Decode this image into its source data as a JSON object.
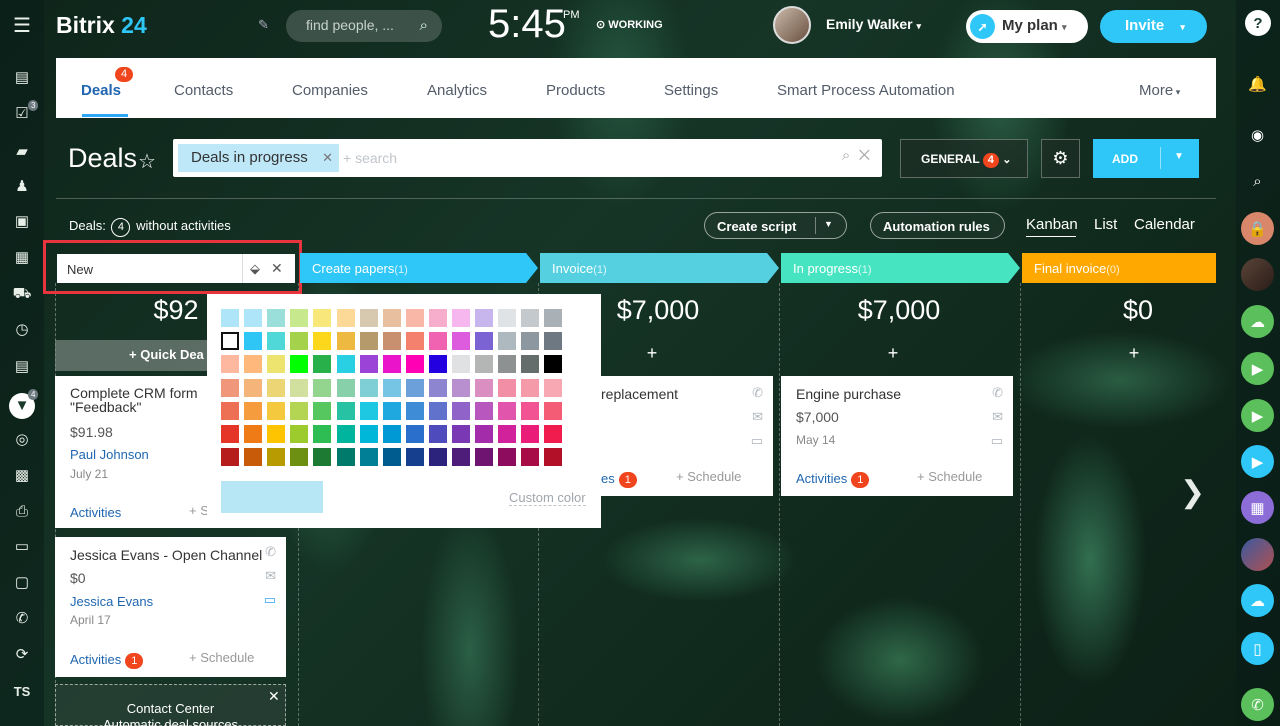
{
  "app": {
    "logo_a": "Bitrix",
    "logo_b": " 24",
    "search_placeholder": "find people, ...",
    "time": "5:45",
    "ampm": "PM",
    "status": "WORKING",
    "user": "Emily Walker",
    "myplan": "My plan",
    "invite": "Invite"
  },
  "left_badges": {
    "tasks": "3",
    "crm": "4"
  },
  "left_bottom": "TS",
  "tabs": [
    {
      "label": "Deals",
      "badge": "4"
    },
    {
      "label": "Contacts"
    },
    {
      "label": "Companies"
    },
    {
      "label": "Analytics"
    },
    {
      "label": "Products"
    },
    {
      "label": "Settings"
    },
    {
      "label": "Smart Process Automation"
    },
    {
      "label": "More"
    }
  ],
  "page": {
    "title": "Deals",
    "filter_chip": "Deals in progress",
    "filter_placeholder": "+ search",
    "general": "GENERAL",
    "general_badge": "4",
    "add": "ADD"
  },
  "subbar": {
    "deals_label": "Deals:",
    "deals_count": "4",
    "deals_suffix": "without activities",
    "create_script": "Create script",
    "automation_rules": "Automation rules",
    "views": [
      "Kanban",
      "List",
      "Calendar"
    ]
  },
  "columns": [
    {
      "name": "New",
      "count": "",
      "sum": "$92",
      "color": "#ffffff"
    },
    {
      "name": "Create papers",
      "count": "(1)",
      "sum": "",
      "color": "#2fc7f7"
    },
    {
      "name": "Invoice",
      "count": "(1)",
      "sum": "$7,000",
      "color": "#55d0e0"
    },
    {
      "name": "In progress",
      "count": "(1)",
      "sum": "$7,000",
      "color": "#47e4c2"
    },
    {
      "name": "Final invoice",
      "count": "(0)",
      "sum": "$0",
      "color": "#ffa900"
    }
  ],
  "quick_deal": "+ Quick Dea",
  "cards": {
    "c1": {
      "title": "Complete CRM form \"Feedback\"",
      "amount": "$91.98",
      "contact": "Paul Johnson",
      "date": "July 21",
      "activities": "Activities",
      "schedule": "+ S"
    },
    "c2": {
      "title": "Jessica Evans - Open Channel",
      "amount": "$0",
      "contact": "Jessica Evans",
      "date": "April 17",
      "activities": "Activities",
      "badge": "1",
      "schedule": "+ Schedule"
    },
    "c3": {
      "title": "replacement",
      "activities": "es",
      "badge": "1",
      "schedule": "+ Schedule"
    },
    "c4": {
      "title": "Engine purchase",
      "amount": "$7,000",
      "date": "May 14",
      "activities": "Activities",
      "badge": "1",
      "schedule": "+ Schedule"
    }
  },
  "contact_center": {
    "title": "Contact Center",
    "subtitle": "Automatic deal sources"
  },
  "palette": {
    "custom_label": "Custom color",
    "rows": [
      [
        "#aee5f8",
        "#aee5f8",
        "#9adfd9",
        "#c8e88d",
        "#f8e87c",
        "#fcd996",
        "#d6c9b0",
        "#e8c0a0",
        "#f8b7a7",
        "#f7aecd",
        "#f6b6ee",
        "#c7b6ee",
        "#dfe3e6",
        "#c3c9cd",
        "#a9b1b7"
      ],
      [
        "#ffffff",
        "#2fc6f6",
        "#50d7d7",
        "#a4d34b",
        "#fcd71c",
        "#eeb941",
        "#b59b6c",
        "#c99070",
        "#f4816d",
        "#f063b1",
        "#dc5cdd",
        "#7b63d4",
        "#adb8bf",
        "#8c97a0",
        "#6d7882"
      ],
      [
        "#ffb8a0",
        "#ffb87c",
        "#ede36f",
        "#00ff00",
        "#28b04a",
        "#29cfe2",
        "#9b43d6",
        "#ea14cb",
        "#ff00b4",
        "#2200e0",
        "#dfe1e2",
        "#b4b5b5",
        "#8d9192",
        "#656c6c",
        "#000000"
      ],
      [
        "#f0967a",
        "#f5b57a",
        "#ecd574",
        "#d1e09f",
        "#93d48e",
        "#87d0a9",
        "#7ed0d6",
        "#77c5e4",
        "#6ca0db",
        "#8d85cf",
        "#b990cf",
        "#db8ec2",
        "#f28ea6",
        "#f59aa9",
        "#f7a8b3"
      ],
      [
        "#ed7054",
        "#f59d3e",
        "#f4c93d",
        "#b4d453",
        "#56c75f",
        "#27c2a4",
        "#1ec8e3",
        "#1fa8e0",
        "#3e8cd6",
        "#6172cc",
        "#8f63c8",
        "#b858be",
        "#e255ad",
        "#f25493",
        "#f45b75"
      ],
      [
        "#e53428",
        "#ef7b16",
        "#ffc400",
        "#9dcb2e",
        "#2dbd52",
        "#00b59e",
        "#00b6d9",
        "#0099d6",
        "#2a6fcb",
        "#4e4cbd",
        "#7b38b5",
        "#a32caa",
        "#d1219b",
        "#ea1e78",
        "#f01c4d"
      ],
      [
        "#b71c1c",
        "#c75b0a",
        "#b79b00",
        "#6d8f12",
        "#1d7a32",
        "#007a6a",
        "#007f96",
        "#005c8e",
        "#163f8e",
        "#2b237c",
        "#4e1d7a",
        "#6f1470",
        "#8e0c5e",
        "#a70c46",
        "#b11028"
      ]
    ],
    "selected_index": [
      1,
      0
    ],
    "preview_color": "#b7e6f4"
  }
}
